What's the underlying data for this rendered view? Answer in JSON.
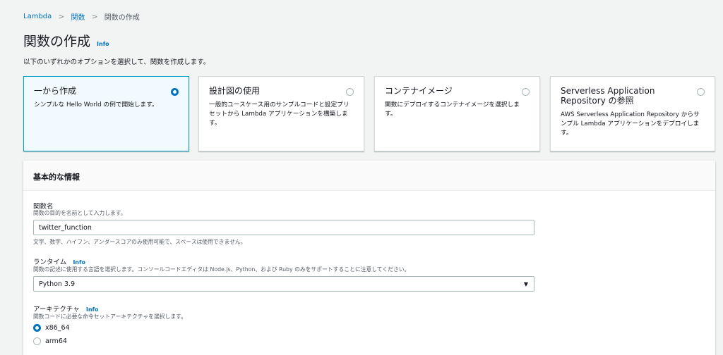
{
  "breadcrumb": {
    "items": [
      "Lambda",
      "関数"
    ],
    "current": "関数の作成"
  },
  "page": {
    "title": "関数の作成",
    "info": "Info",
    "subtitle": "以下のいずれかのオプションを選択して、関数を作成します。"
  },
  "options": [
    {
      "title": "一から作成",
      "desc": "シンプルな Hello World の例で開始します。",
      "selected": true
    },
    {
      "title": "設計図の使用",
      "desc": "一般的ユースケース用のサンプルコードと設定プリセットから Lambda アプリケーションを構築します。",
      "selected": false
    },
    {
      "title": "コンテナイメージ",
      "desc": "関数にデプロイするコンテナイメージを選択します。",
      "selected": false
    },
    {
      "title": "Serverless Application Repository の参照",
      "desc": "AWS Serverless Application Repository からサンプル Lambda アプリケーションをデプロイします。",
      "selected": false
    }
  ],
  "basic": {
    "heading": "基本的な情報",
    "function_name": {
      "label": "関数名",
      "desc": "関数の目的を名前として入力します。",
      "value": "twitter_function",
      "hint": "文字、数字、ハイフン、アンダースコアのみ使用可能で、スペースは使用できません。"
    },
    "runtime": {
      "label": "ランタイム",
      "info": "Info",
      "desc": "関数の記述に使用する言語を選択します。コンソールコードエディタは Node.js、Python、および Ruby のみをサポートすることに注意してください。",
      "value": "Python 3.9"
    },
    "architecture": {
      "label": "アーキテクチャ",
      "info": "Info",
      "desc": "関数コードに必要な命令セットアーキテクチャを選択します。",
      "options": [
        "x86_64",
        "arm64"
      ],
      "selected": "x86_64"
    }
  }
}
